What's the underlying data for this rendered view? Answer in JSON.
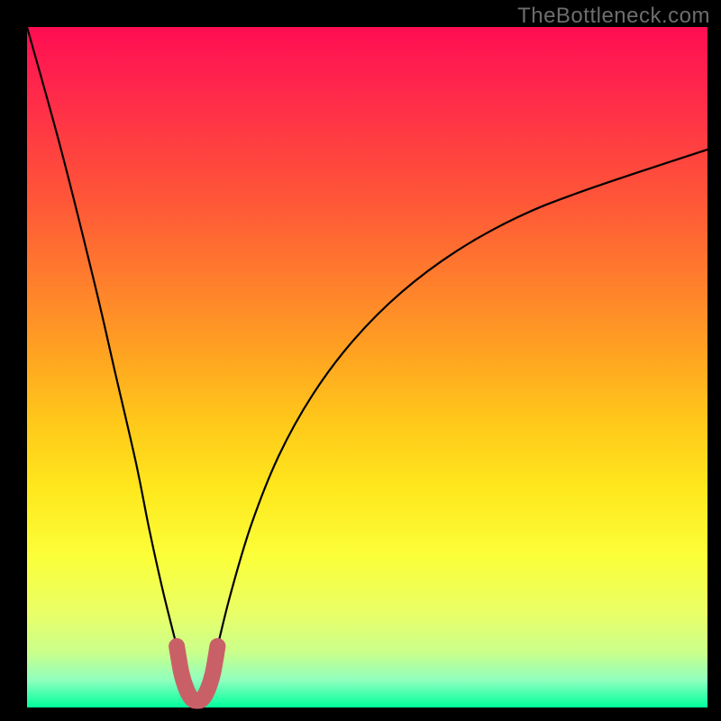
{
  "watermark": "TheBottleneck.com",
  "chart_data": {
    "type": "line",
    "title": "",
    "xlabel": "",
    "ylabel": "",
    "xlim": [
      0,
      100
    ],
    "ylim": [
      0,
      100
    ],
    "grid": false,
    "series": [
      {
        "name": "bottleneck-curve",
        "color": "#000000",
        "x": [
          0,
          5,
          10,
          13,
          16,
          18,
          20,
          22,
          23,
          24,
          25,
          26,
          27,
          28,
          30,
          33,
          37,
          42,
          48,
          55,
          63,
          72,
          82,
          100
        ],
        "values": [
          100,
          82,
          62,
          49,
          36,
          26,
          17,
          9,
          5,
          2,
          1,
          2,
          5,
          9,
          17,
          27,
          37,
          46,
          54,
          61,
          67,
          72,
          76,
          82
        ]
      },
      {
        "name": "highlight-u",
        "color": "#c96067",
        "x": [
          22,
          22.7,
          23.5,
          24.3,
          25,
          25.7,
          26.5,
          27.3,
          28
        ],
        "values": [
          9,
          5,
          2.5,
          1.2,
          1,
          1.2,
          2.5,
          5,
          9
        ]
      }
    ]
  }
}
